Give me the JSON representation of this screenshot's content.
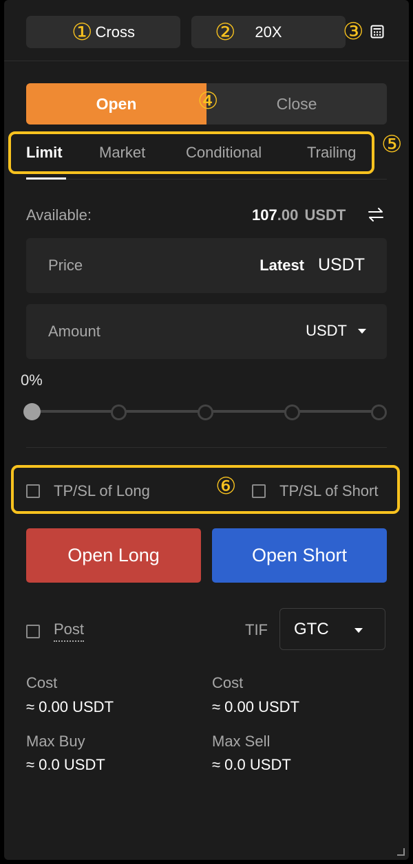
{
  "header": {
    "margin_mode": "Cross",
    "leverage": "20X",
    "marker1": "①",
    "marker2": "②",
    "marker3": "③",
    "calculator_icon": "calculator-icon"
  },
  "side_toggle": {
    "open_label": "Open",
    "close_label": "Close",
    "marker4": "④",
    "active": "open",
    "active_color": "#ef8a33"
  },
  "order_tabs": {
    "items": [
      "Limit",
      "Market",
      "Conditional",
      "Trailing"
    ],
    "active": "Limit",
    "marker5": "⑤"
  },
  "available": {
    "label": "Available:",
    "amount_int": "107",
    "amount_dec": ".00",
    "currency": "USDT",
    "transfer_icon": "swap-arrows-icon"
  },
  "price_field": {
    "label": "Price",
    "mode": "Latest",
    "unit": "USDT"
  },
  "amount_field": {
    "label": "Amount",
    "unit": "USDT"
  },
  "slider": {
    "percent_label": "0%",
    "value": 0
  },
  "tpsl": {
    "long_label": "TP/SL of Long",
    "short_label": "TP/SL of Short",
    "marker6": "⑥"
  },
  "actions": {
    "open_long": "Open Long",
    "open_short": "Open Short",
    "long_color": "#c2433b",
    "short_color": "#2e62cf"
  },
  "post": {
    "label": "Post"
  },
  "tif": {
    "label": "TIF",
    "selected": "GTC"
  },
  "summary": {
    "left": {
      "cost_label": "Cost",
      "cost_value": "≈ 0.00 USDT",
      "max_label": "Max Buy",
      "max_value": "≈ 0.0 USDT"
    },
    "right": {
      "cost_label": "Cost",
      "cost_value": "≈ 0.00 USDT",
      "max_label": "Max Sell",
      "max_value": "≈ 0.0 USDT"
    }
  },
  "highlight_color": "#f8c21f"
}
